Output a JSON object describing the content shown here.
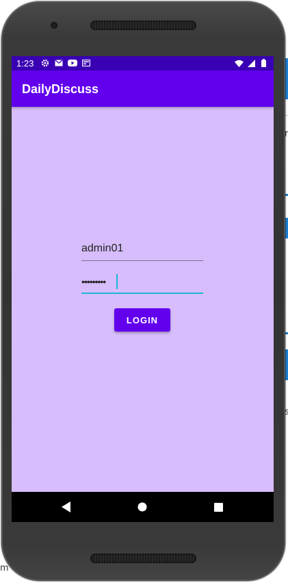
{
  "status_bar": {
    "time": "1:23",
    "left_icons": [
      "gear-icon",
      "mail-icon",
      "youtube-icon",
      "card-icon"
    ],
    "right_icons": [
      "wifi-icon",
      "signal-icon",
      "battery-icon"
    ]
  },
  "app_bar": {
    "title": "DailyDiscuss"
  },
  "login_form": {
    "username_value": "admin01",
    "password_value": "•••••••••",
    "login_label": "LOGIN"
  },
  "nav_bar": {
    "buttons": [
      "back-icon",
      "home-icon",
      "recents-icon"
    ]
  },
  "background": {
    "letters": [
      "r",
      "s",
      "m"
    ]
  },
  "colors": {
    "status_bar": "#3a00b3",
    "app_bar": "#6200ee",
    "screen_bg": "#d7bdfc",
    "focus_accent": "#1ab7d6",
    "button": "#6200ee"
  }
}
